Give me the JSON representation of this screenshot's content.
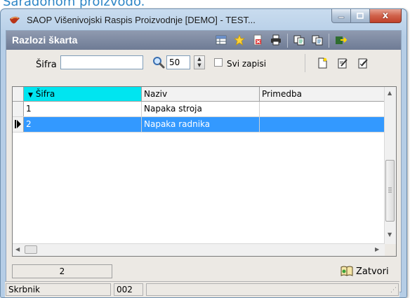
{
  "caption_text": "Saradohom proizvodo.",
  "window": {
    "title": "SAOP Višenivojski Raspis Proizvodnje [DEMO] - TEST...",
    "close_glyph": "x"
  },
  "panel": {
    "title": "Razlozi škarta"
  },
  "filter": {
    "sifra_label": "Šifra",
    "sifra_value": "",
    "count_value": "50",
    "all_records_label": "Svi zapisi"
  },
  "grid": {
    "columns": [
      "Šifra",
      "Naziv",
      "Primedba"
    ],
    "rows": [
      {
        "sifra": "1",
        "naziv": "Napaka stroja",
        "primedba": ""
      },
      {
        "sifra": "2",
        "naziv": "Napaka radnika",
        "primedba": ""
      }
    ],
    "selected_row": 2
  },
  "footer": {
    "record_count": "2",
    "close_label": "Zatvori"
  },
  "status": {
    "user": "Skrbnik",
    "code": "002"
  },
  "colors": {
    "header_bar": "#7b87a0",
    "sorted_column": "#00e5f0",
    "selection": "#3399ff",
    "caption_text": "#2e86c6"
  },
  "icons": [
    "app-icon",
    "table-icon",
    "star-icon",
    "delete-icon",
    "print-icon",
    "copy-icon",
    "copy2-icon",
    "exit-icon",
    "search-icon",
    "new-record-icon",
    "edit-icon",
    "edit-all-icon",
    "close-book-icon"
  ]
}
